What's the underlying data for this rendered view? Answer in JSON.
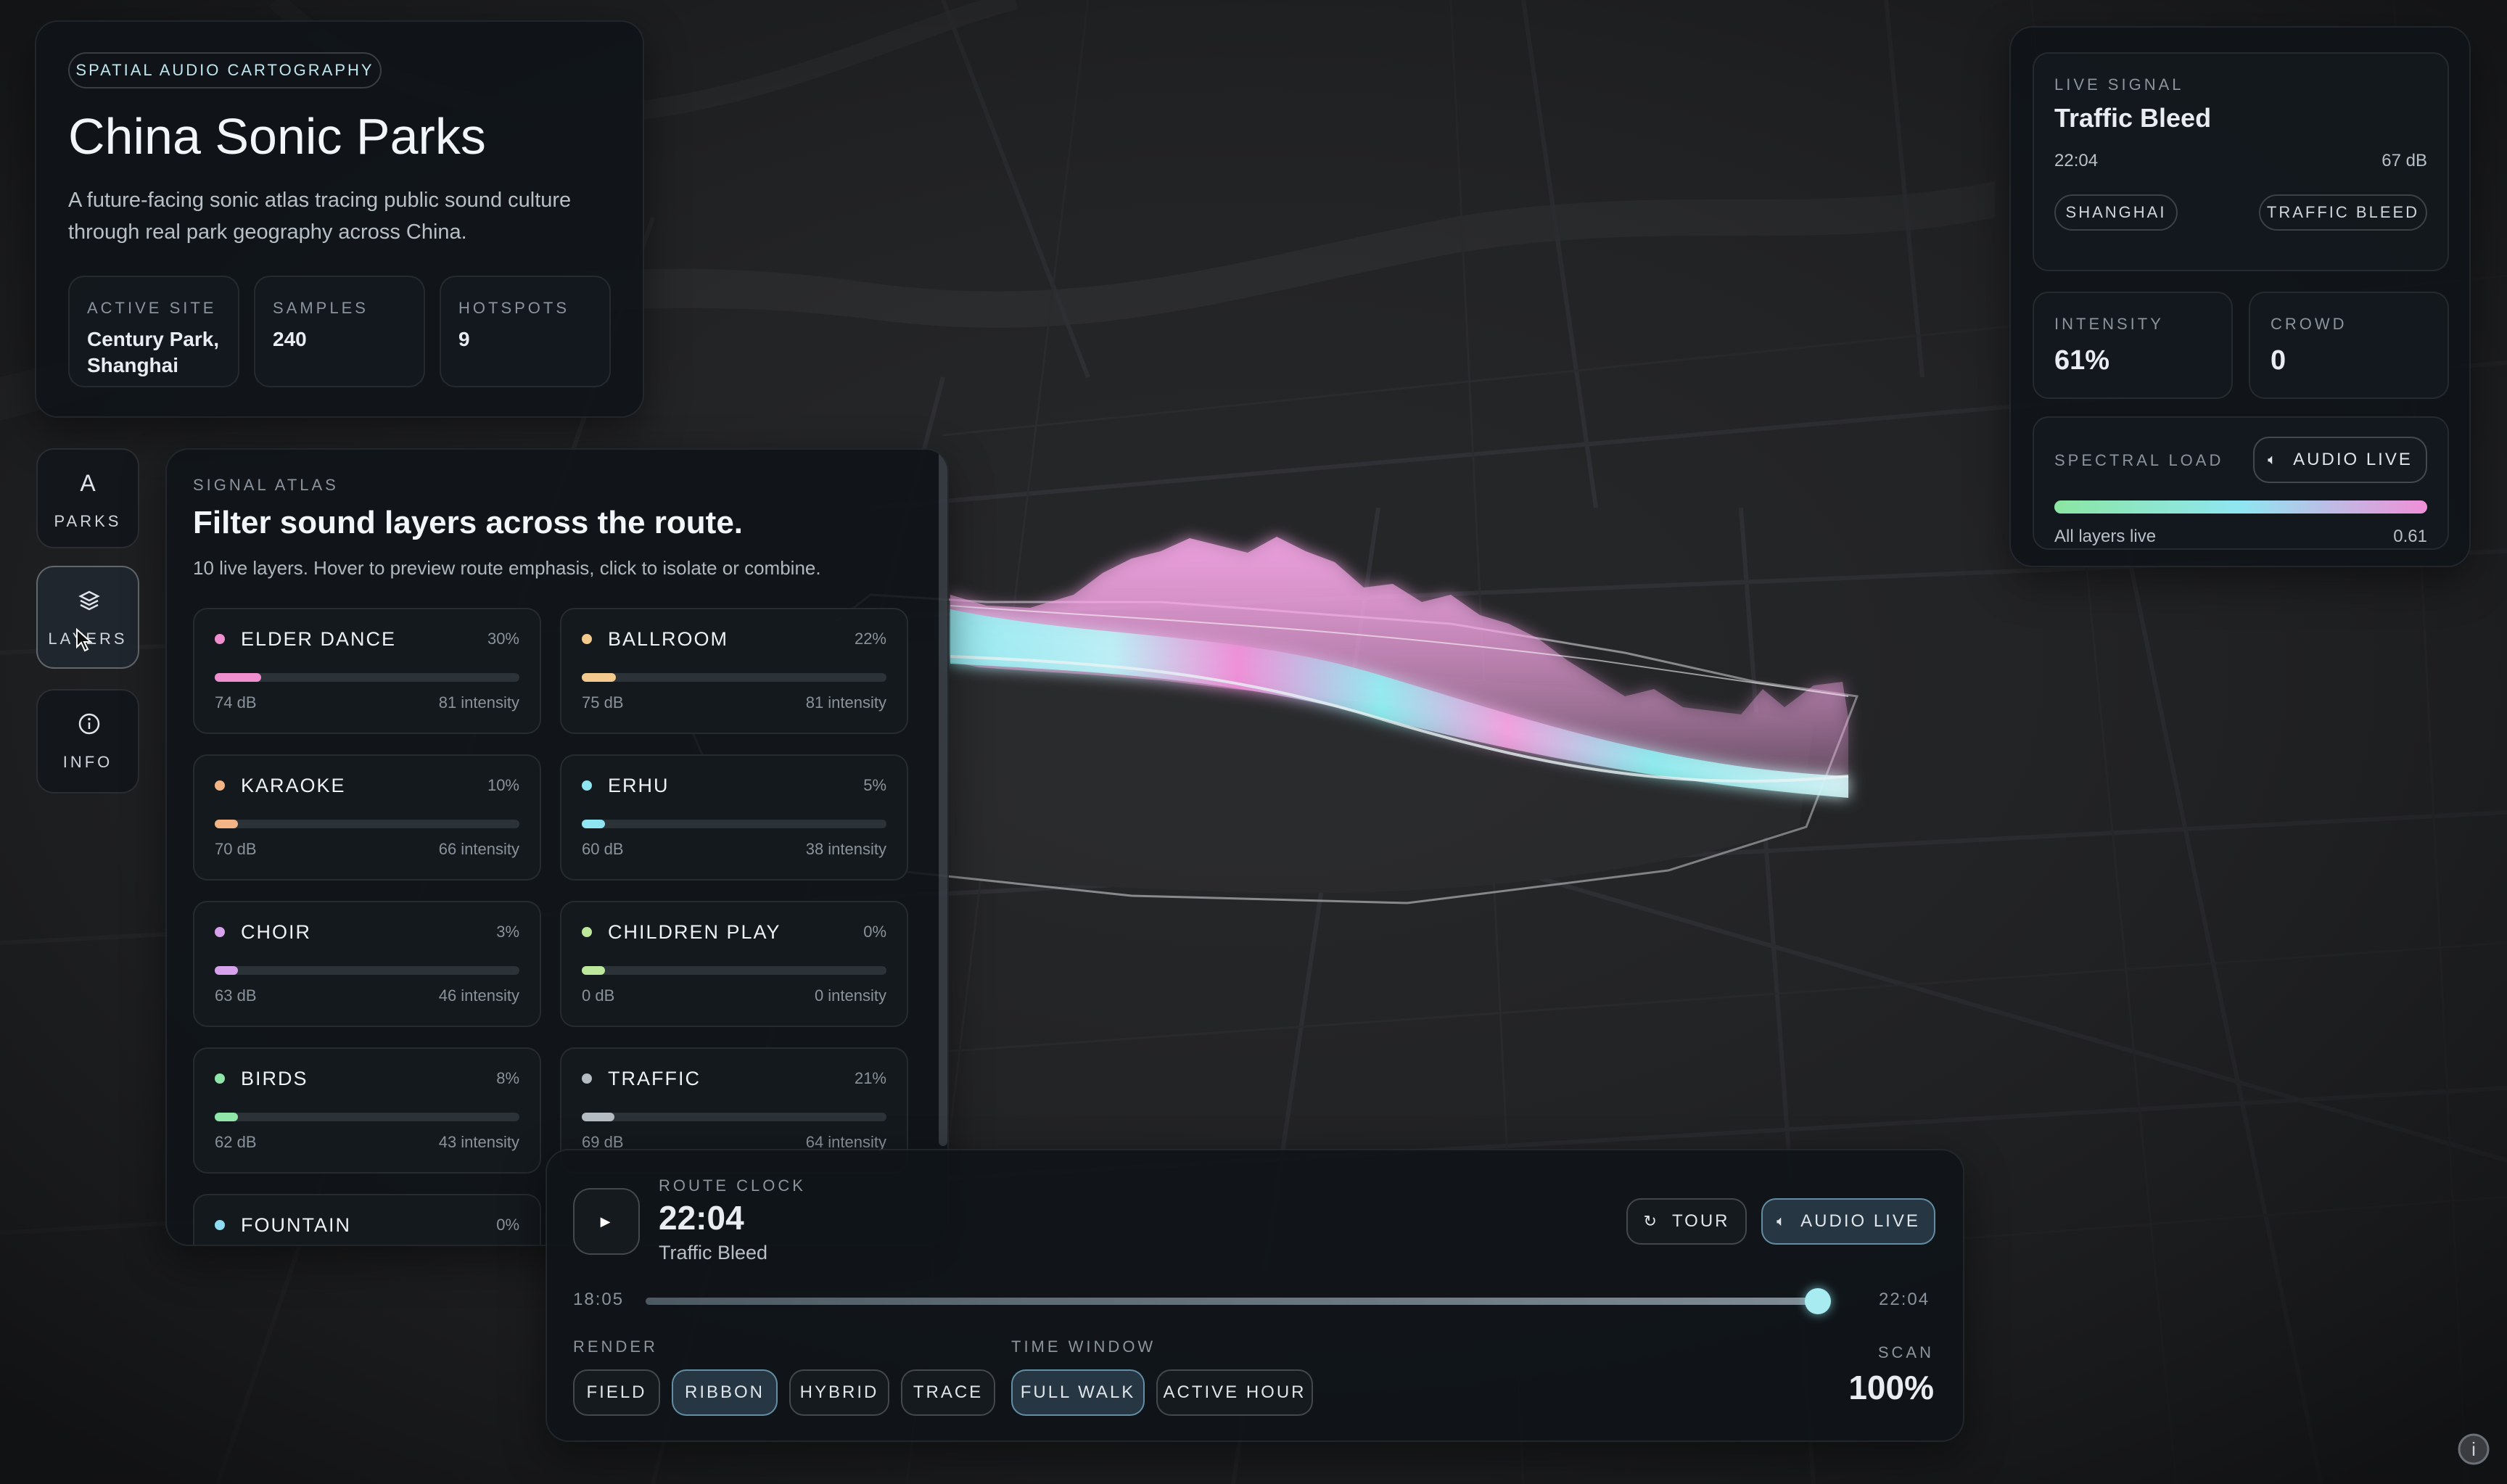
{
  "app": {
    "eyebrow": "SPATIAL AUDIO CARTOGRAPHY",
    "title": "China Sonic Parks",
    "subtitle_line1": "A future-facing sonic atlas tracing public sound culture",
    "subtitle_line2": "through real park geography across China.",
    "stats": {
      "active_site_label": "ACTIVE SITE",
      "active_site_line1": "Century Park,",
      "active_site_line2": "Shanghai",
      "samples_label": "SAMPLES",
      "samples_value": "240",
      "hotspots_label": "HOTSPOTS",
      "hotspots_value": "9"
    }
  },
  "nav": {
    "parks_label": "PARKS",
    "parks_icon": "A",
    "layers_label": "LAYERS",
    "info_label": "INFO"
  },
  "atlas": {
    "eyebrow": "SIGNAL ATLAS",
    "title": "Filter sound layers across the route.",
    "description": "10 live layers. Hover to preview route emphasis, click to isolate or combine.",
    "layers": [
      {
        "name": "ELDER DANCE",
        "pct": "30%",
        "level": 0.3,
        "db": "74 dB",
        "intensity": "81 intensity",
        "color": "#f08fd0"
      },
      {
        "name": "BALLROOM",
        "pct": "22%",
        "level": 0.22,
        "db": "75 dB",
        "intensity": "81 intensity",
        "color": "#f3c98d"
      },
      {
        "name": "KARAOKE",
        "pct": "10%",
        "level": 0.1,
        "db": "70 dB",
        "intensity": "66 intensity",
        "color": "#f3b486"
      },
      {
        "name": "ERHU",
        "pct": "5%",
        "level": 0.05,
        "db": "60 dB",
        "intensity": "38 intensity",
        "color": "#8fe6f2"
      },
      {
        "name": "CHOIR",
        "pct": "3%",
        "level": 0.03,
        "db": "63 dB",
        "intensity": "46 intensity",
        "color": "#d6a2ec"
      },
      {
        "name": "CHILDREN PLAY",
        "pct": "0%",
        "level": 0.0,
        "db": "0 dB",
        "intensity": "0 intensity",
        "color": "#bde79a"
      },
      {
        "name": "BIRDS",
        "pct": "8%",
        "level": 0.08,
        "db": "62 dB",
        "intensity": "43 intensity",
        "color": "#8fe6a8"
      },
      {
        "name": "TRAFFIC",
        "pct": "21%",
        "level": 0.21,
        "db": "69 dB",
        "intensity": "64 intensity",
        "color": "#b4bcc4"
      },
      {
        "name": "FOUNTAIN",
        "pct": "0%",
        "level": 0.0,
        "db": "",
        "intensity": "",
        "color": "#8fdcf2"
      }
    ]
  },
  "live": {
    "eyebrow": "LIVE SIGNAL",
    "title": "Traffic Bleed",
    "time": "22:04",
    "db": "67 dB",
    "tag_city": "SHANGHAI",
    "tag_layer": "TRAFFIC BLEED",
    "intensity_label": "INTENSITY",
    "intensity_value": "61%",
    "crowd_label": "CROWD",
    "crowd_value": "0",
    "spectral_label": "SPECTRAL LOAD",
    "audio_button": "AUDIO LIVE",
    "spectral_caption": "All layers live",
    "spectral_value": "0.61",
    "spectral_level": 0.61
  },
  "clock": {
    "eyebrow": "ROUTE CLOCK",
    "time": "22:04",
    "layer": "Traffic Bleed",
    "tour_label": "TOUR",
    "audio_label": "AUDIO LIVE",
    "start_time": "18:05",
    "end_time": "22:04",
    "progress": 1.0,
    "render_label": "RENDER",
    "render_modes": [
      "FIELD",
      "RIBBON",
      "HYBRID",
      "TRACE"
    ],
    "render_active": "RIBBON",
    "window_label": "TIME WINDOW",
    "window_modes": [
      "FULL WALK",
      "ACTIVE HOUR"
    ],
    "window_active": "FULL WALK",
    "scan_label": "SCAN",
    "scan_value": "100%"
  },
  "colors": {
    "cyan": "#8ff0f2",
    "pink": "#f08fd8",
    "green": "#8be6a2"
  },
  "icons": {
    "play": "play-icon",
    "tour": "tour-icon",
    "speaker": "speaker-icon",
    "layers": "layers-icon",
    "info": "info-icon"
  }
}
